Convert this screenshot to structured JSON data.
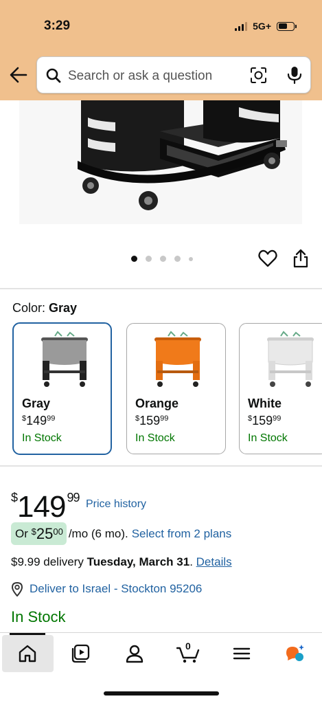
{
  "status_bar": {
    "time": "3:29",
    "network": "5G+"
  },
  "search": {
    "placeholder": "Search or ask a question"
  },
  "gallery": {
    "total_images": 5,
    "current_index": 1
  },
  "color_selector": {
    "label": "Color:",
    "selected": "Gray",
    "options": [
      {
        "name": "Gray",
        "price_dollars": "149",
        "price_cents": "99",
        "stock": "In Stock",
        "swatch_color": "#9a9a9a"
      },
      {
        "name": "Orange",
        "price_dollars": "159",
        "price_cents": "99",
        "stock": "In Stock",
        "swatch_color": "#f07a1a"
      },
      {
        "name": "White",
        "price_dollars": "159",
        "price_cents": "99",
        "stock": "In Stock",
        "swatch_color": "#e9e9e9"
      }
    ]
  },
  "price": {
    "currency": "$",
    "dollars": "149",
    "cents": "99",
    "history_link": "Price history"
  },
  "monthly": {
    "prefix": "Or",
    "currency": "$",
    "dollars": "25",
    "cents": "00",
    "suffix": "/mo (6 mo).",
    "link": "Select from 2 plans"
  },
  "delivery": {
    "fee": "$9.99 delivery",
    "date": "Tuesday, March 31",
    "period": ".",
    "details_link": "Details"
  },
  "deliver_to": {
    "text": "Deliver to Israel - Stockton 95206"
  },
  "availability": "In Stock",
  "bottom_nav": {
    "items": [
      "home-icon",
      "video-icon",
      "account-icon",
      "cart-icon",
      "menu-icon",
      "rufus-icon"
    ],
    "cart_count": "0"
  },
  "colors": {
    "header_bg": "#f0c08d",
    "link": "#2162a1",
    "in_stock": "#007600",
    "selected_border": "#2162a1",
    "monthly_pill": "#c9ead4"
  }
}
